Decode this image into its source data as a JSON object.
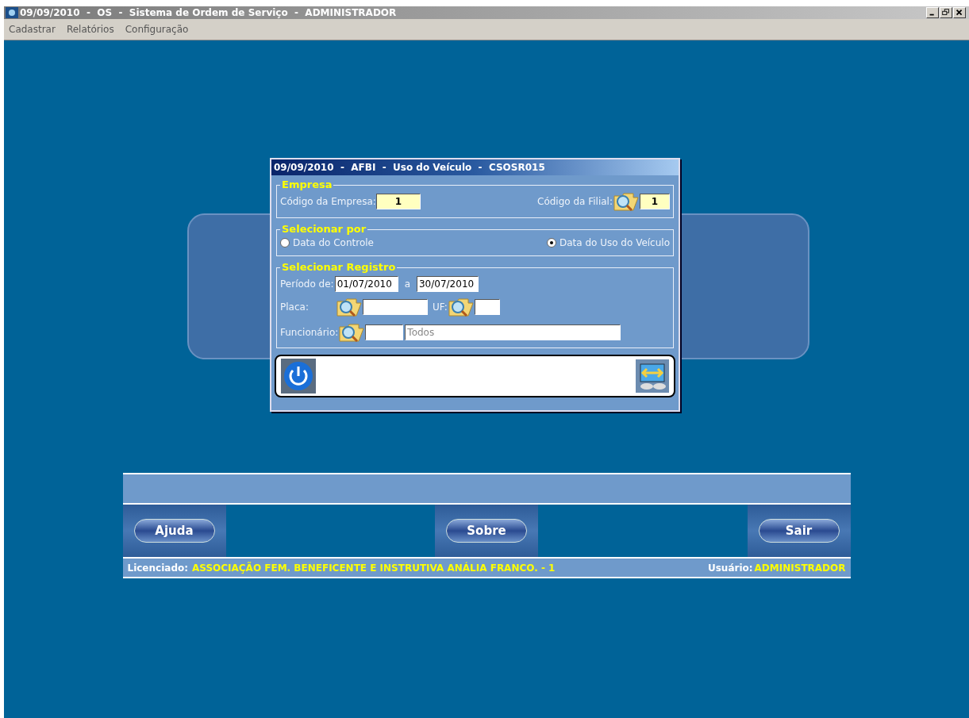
{
  "window": {
    "title": "09/09/2010  -  OS  -  Sistema de Ordem de Serviço  -  ADMINISTRADOR"
  },
  "menu": [
    "Cadastrar",
    "Relatórios",
    "Configuração"
  ],
  "dialog": {
    "title": "09/09/2010  -  AFBI  -  Uso do Veículo  -  CSOSR015",
    "empresa": {
      "legend": "Empresa",
      "company_label": "Código da Empresa:",
      "company_value": "1",
      "branch_label": "Código da Filial:",
      "branch_value": "1"
    },
    "select_by": {
      "legend": "Selecionar por",
      "options": [
        {
          "label": "Data do Controle",
          "selected": false
        },
        {
          "label": "Data do Uso do Veículo",
          "selected": true
        }
      ]
    },
    "registro": {
      "legend": "Selecionar Registro",
      "period_label": "Período de:",
      "date_from": "01/07/2010",
      "between": "a",
      "date_to": "30/07/2010",
      "plate_label": "Placa:",
      "uf_label": "UF:",
      "employee_label": "Funcionário:",
      "employee_name": "Todos"
    }
  },
  "footer": {
    "buttons": [
      "Ajuda",
      "Sobre",
      "Sair"
    ],
    "licensee_label": "Licenciado:",
    "licensee": "ASSOCIAÇÃO FEM. BENEFICENTE E INSTRUTIVA ANÁLIA FRANCO. - 1",
    "user_label": "Usuário:",
    "user": "ADMINISTRADOR"
  }
}
